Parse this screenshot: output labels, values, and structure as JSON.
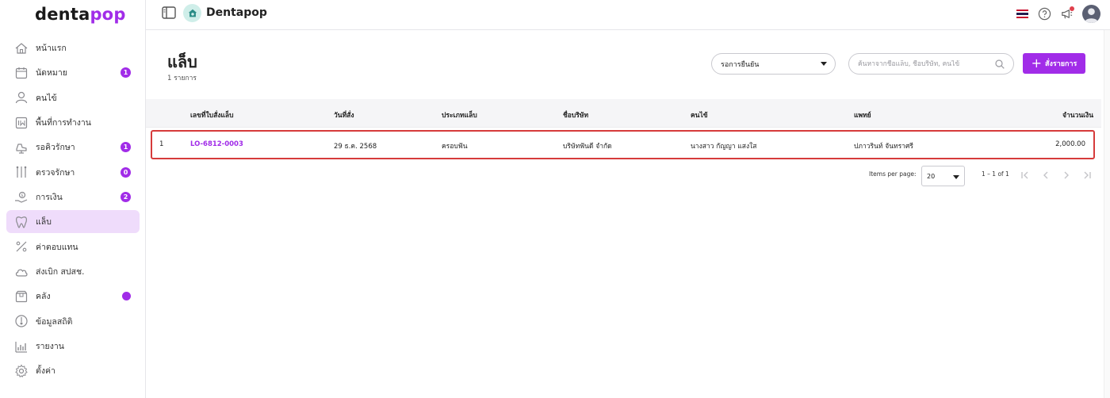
{
  "logo": {
    "part1": "denta",
    "part2": "p",
    "part3": "o",
    "part4": "p"
  },
  "sidebar": {
    "items": [
      {
        "label": "หน้าแรก",
        "icon": "home-icon",
        "badge": ""
      },
      {
        "label": "นัดหมาย",
        "icon": "calendar-icon",
        "badge": "1"
      },
      {
        "label": "คนไข้",
        "icon": "user-icon",
        "badge": ""
      },
      {
        "label": "พื้นที่การทำงาน",
        "icon": "workspace-icon",
        "badge": ""
      },
      {
        "label": "รอคิวรักษา",
        "icon": "dental-chair-icon",
        "badge": "1"
      },
      {
        "label": "ตรวจรักษา",
        "icon": "dental-tools-icon",
        "badge": "0"
      },
      {
        "label": "การเงิน",
        "icon": "money-hand-icon",
        "badge": "2"
      },
      {
        "label": "แล็บ",
        "icon": "tooth-icon",
        "badge": ""
      },
      {
        "label": "ค่าตอบแทน",
        "icon": "percent-icon",
        "badge": ""
      },
      {
        "label": "ส่งเบิก สปสช.",
        "icon": "cloud-icon",
        "badge": ""
      },
      {
        "label": "คลัง",
        "icon": "box-icon",
        "badge": "dot"
      },
      {
        "label": "ข้อมูลสถิติ",
        "icon": "thermometer-icon",
        "badge": ""
      },
      {
        "label": "รายงาน",
        "icon": "bar-chart-icon",
        "badge": ""
      },
      {
        "label": "ตั้งค่า",
        "icon": "gear-icon",
        "badge": ""
      }
    ],
    "active_index": 7
  },
  "topbar": {
    "clinic_name": "Dentapop"
  },
  "page": {
    "title": "แล็บ",
    "count": "1 รายการ",
    "status_filter": "รอการยืนยัน",
    "search_placeholder": "ค้นหาจากชื่อแล็บ, ชื่อบริษัท, คนไข้",
    "order_button": "สั่งรายการ"
  },
  "table": {
    "headers": [
      "เลขที่ใบสั่งแล็บ",
      "วันที่สั่ง",
      "ประเภทแล็บ",
      "ชื่อบริษัท",
      "คนไข้",
      "แพทย์",
      "จำนวนเงิน"
    ],
    "rows": [
      {
        "index": "1",
        "order_no": "LO-6812-0003",
        "date": "29 ธ.ค. 2568",
        "lab_type": "ครอบฟัน",
        "company": "บริษัทฟันดี จำกัด",
        "patient": "นางสาว กัญญา แสงใส",
        "doctor": "ปภาวรินท์ จันทราศรี",
        "amount": "2,000.00"
      }
    ]
  },
  "pagination": {
    "items_per_page_label": "Items per page:",
    "items_per_page": "20",
    "range": "1 – 1 of 1"
  },
  "colors": {
    "accent": "#a12ce8",
    "active_bg": "#efdcfb",
    "highlight_border": "#d63b3b"
  }
}
